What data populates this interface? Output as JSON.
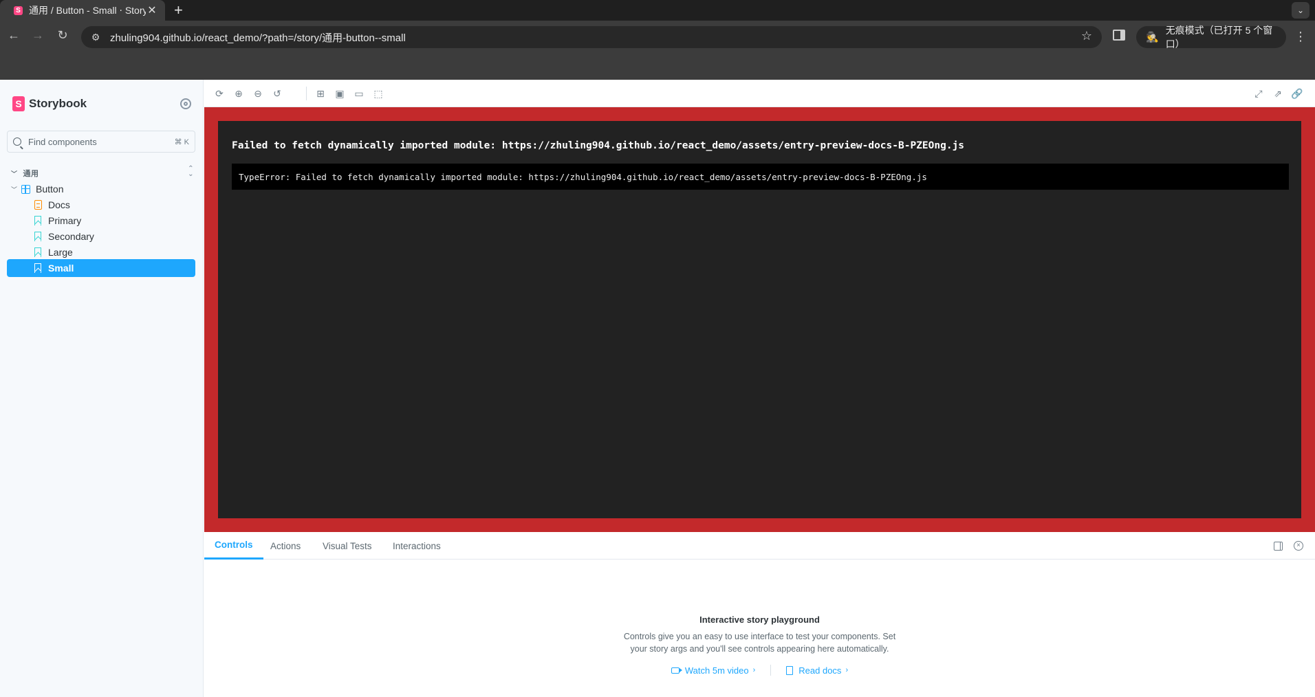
{
  "browser": {
    "tab_title": "通用 / Button - Small ⋅ Storyb",
    "tab_close": "✕",
    "new_tab": "+",
    "tab_menu": "⌄",
    "url": "zhuling904.github.io/react_demo/?path=/story/通用-button--small",
    "incognito_label": "无痕模式（已打开 5 个窗口）",
    "icons": {
      "back": "←",
      "forward": "→",
      "reload": "↻",
      "star": "☆",
      "kebab": "⋮",
      "tune": "⚙",
      "incognito": "🕵"
    }
  },
  "sidebar": {
    "brand": "Storybook",
    "brand_logo_letter": "S",
    "search_placeholder": "Find components",
    "search_shortcut": "⌘ K",
    "group_label": "通用",
    "component": "Button",
    "items": [
      {
        "label": "Docs",
        "type": "docs"
      },
      {
        "label": "Primary",
        "type": "story"
      },
      {
        "label": "Secondary",
        "type": "story"
      },
      {
        "label": "Large",
        "type": "story"
      },
      {
        "label": "Small",
        "type": "story",
        "selected": true
      }
    ]
  },
  "toolbar": {
    "icons": [
      "remount",
      "zoom-in",
      "zoom-out",
      "zoom-reset",
      "grid",
      "background",
      "viewport",
      "outline",
      "fullscreen",
      "open-new-tab",
      "copy-link"
    ]
  },
  "error": {
    "message": "Failed to fetch dynamically imported module: https://zhuling904.github.io/react_demo/assets/entry-preview-docs-B-PZEOng.js",
    "stack": "TypeError: Failed to fetch dynamically imported module: https://zhuling904.github.io/react_demo/assets/entry-preview-docs-B-PZEOng.js"
  },
  "addons": {
    "tabs": [
      "Controls",
      "Actions",
      "Visual Tests",
      "Interactions"
    ],
    "active_tab": "Controls",
    "empty_title": "Interactive story playground",
    "empty_desc": "Controls give you an easy to use interface to test your components. Set your story args and you'll see controls appearing here automatically.",
    "watch_video": "Watch 5m video",
    "read_docs": "Read docs"
  },
  "colors": {
    "accent": "#1ea7fd",
    "storybook_pink": "#ff4785",
    "error_border": "#c3292b",
    "error_bg": "#222222"
  }
}
